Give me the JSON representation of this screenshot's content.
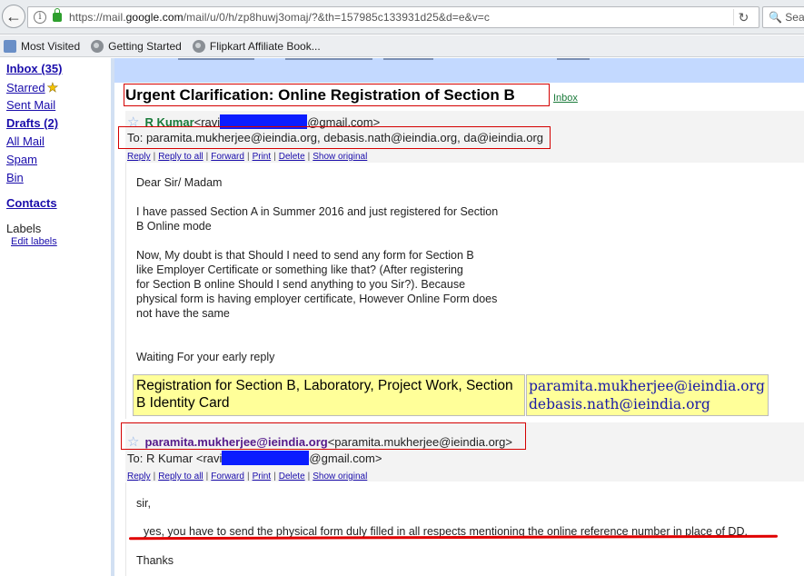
{
  "browser": {
    "url_prefix": "https://mail.",
    "url_host": "google.com",
    "url_suffix": "/mail/u/0/h/zp8huwj3omaj/?&th=157985c133931d25&d=e&v=c",
    "search_placeholder": "Sea",
    "back_icon": "arrow-left-icon",
    "reload_icon": "reload-icon",
    "bookmarks": [
      {
        "label": "Most Visited",
        "icon": "folder-icon"
      },
      {
        "label": "Getting Started",
        "icon": "globe-icon"
      },
      {
        "label": "Flipkart Affiliate Book...",
        "icon": "globe-icon"
      }
    ]
  },
  "sidebar": {
    "inbox": "Inbox (35)",
    "starred": "Starred",
    "sent": "Sent Mail",
    "drafts": "Drafts (2)",
    "all_mail": "All Mail",
    "spam": "Spam",
    "bin": "Bin",
    "contacts": "Contacts",
    "labels": "Labels",
    "edit_labels": "Edit labels"
  },
  "thread": {
    "subject": "Urgent Clarification: Online Registration of Section B",
    "label_tag": "Inbox",
    "messages": [
      {
        "sender_name": "R Kumar",
        "sender_email_prefix": "<ravi",
        "sender_email_suffix": "@gmail.com>",
        "to_line": "To: paramita.mukherjee@ieindia.org, debasis.nath@ieindia.org, da@ieindia.org",
        "body": [
          "Dear Sir/ Madam",
          "I have passed Section A in Summer 2016 and just registered for Section",
          "B Online mode",
          "Now, My doubt is that Should I need to send any form for Section B",
          "like Employer Certificate or something like that? (After registering",
          "for Section B online Should I send anything to you Sir?). Because",
          "physical form is having employer certificate, However Online Form does",
          "not have the same",
          "Waiting For your early reply"
        ],
        "highlight_left": "Registration for Section B, Laboratory, Project Work, Section B Identity Card",
        "highlight_right": [
          "paramita.mukherjee@ieindia.org",
          "debasis.nath@ieindia.org"
        ]
      },
      {
        "sender_name": "paramita.mukherjee@ieindia.org",
        "sender_email": "<paramita.mukherjee@ieindia.org>",
        "to_prefix": "To: R Kumar <ravi",
        "to_suffix": "@gmail.com>",
        "body": [
          "sir,",
          "yes,  you have to send the physical form duly filled in all respects mentioning the online reference number in place of DD.",
          "Thanks"
        ]
      }
    ]
  },
  "actions": [
    "Reply",
    "Reply to all",
    "Forward",
    "Print",
    "Delete",
    "Show original"
  ],
  "colors": {
    "link": "#1a0dab",
    "sender_green": "#1a7a3a",
    "annotation_red": "#d40000",
    "redaction_blue": "#0a1dff",
    "highlight_yellow": "#ffff99",
    "gmail_blue": "#c3d9ff"
  }
}
